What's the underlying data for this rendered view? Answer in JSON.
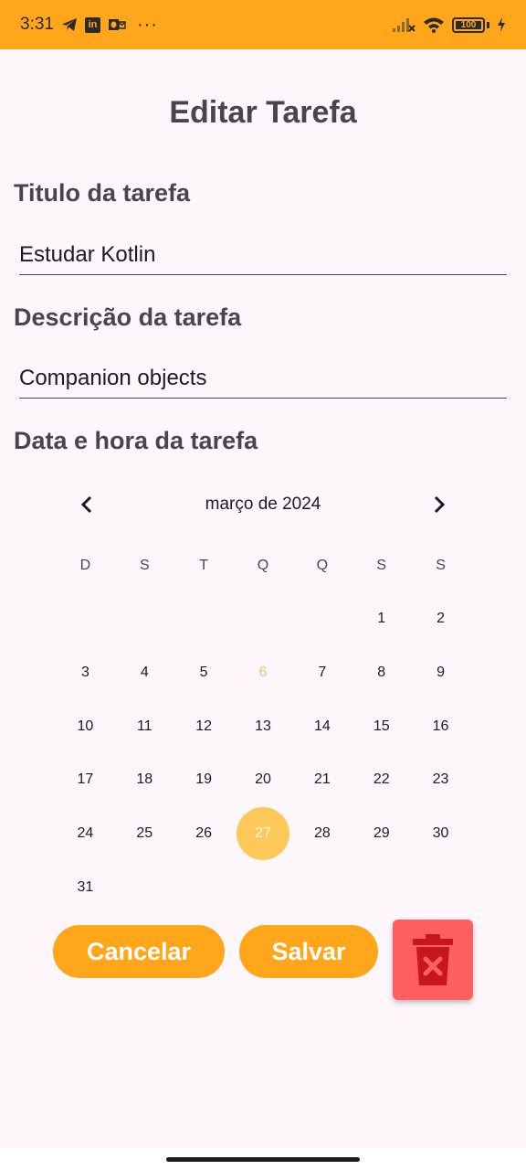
{
  "status_bar": {
    "time": "3:31",
    "battery": "100",
    "icons": [
      "telegram-icon",
      "linkedin-icon",
      "outlook-icon",
      "more-icon",
      "signal-icon",
      "wifi-icon",
      "battery-icon",
      "charging-icon"
    ]
  },
  "page": {
    "title": "Editar Tarefa"
  },
  "form": {
    "title_label": "Titulo da tarefa",
    "title_value": "Estudar Kotlin",
    "description_label": "Descrição da tarefa",
    "description_value": "Companion objects",
    "date_label": "Data e hora da tarefa"
  },
  "calendar": {
    "month_label": "março de 2024",
    "weekdays": [
      "D",
      "S",
      "T",
      "Q",
      "Q",
      "S",
      "S"
    ],
    "leading_blanks": 5,
    "days_in_month": 31,
    "today": 6,
    "selected": 27,
    "today_color": "#f3c470",
    "selected_color": "#ffc95a"
  },
  "actions": {
    "cancel_label": "Cancelar",
    "save_label": "Salvar",
    "delete_icon": "trash-x-icon"
  },
  "colors": {
    "accent": "#ffa61a",
    "delete": "#ff5f5f",
    "background": "#fdf7fc"
  }
}
